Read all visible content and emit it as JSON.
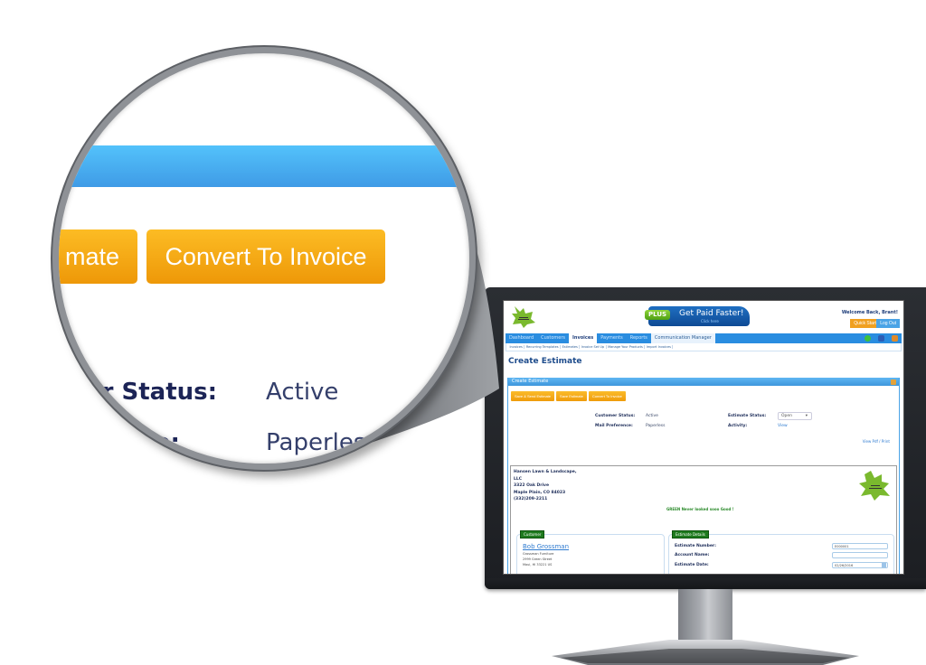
{
  "app": {
    "promo": {
      "badge": "PLUS",
      "title": "Get Paid Faster!",
      "subtitle": "Click here"
    },
    "welcome": "Welcome Back, Brant!",
    "header_buttons": {
      "quick_start": "Quick Start",
      "log_out": "Log Out"
    },
    "nav_tabs": [
      {
        "label": "Dashboard",
        "state": "normal"
      },
      {
        "label": "Customers",
        "state": "normal"
      },
      {
        "label": "Invoices",
        "state": "active"
      },
      {
        "label": "Payments",
        "state": "normal"
      },
      {
        "label": "Reports",
        "state": "normal"
      },
      {
        "label": "Communication Manager",
        "state": "light"
      }
    ],
    "nav_icons": [
      "settings-icon",
      "user-icon",
      "help-icon"
    ],
    "sub_nav": [
      "Invoices",
      "Recurring Templates",
      "Estimates",
      "Invoice Set Up",
      "Manage Your Products",
      "Import Invoices"
    ],
    "page_title": "Create Estimate",
    "panel_title": "Create Estimate",
    "action_buttons": [
      "Save & Send Estimate",
      "Save Estimate",
      "Convert To Invoice"
    ],
    "info": {
      "customer_status_label": "Customer Status:",
      "customer_status": "Active",
      "mail_preference_label": "Mail Preference:",
      "mail_preference": "Paperless",
      "estimate_status_label": "Estimate Status:",
      "estimate_status": "Open",
      "activity_label": "Activity:",
      "activity_link": "View"
    },
    "view_pdf": "View Pdf / Print",
    "company": {
      "line1": "Hansen Lawn & Landscape,",
      "line2": "LLC",
      "line3": "3322 Oak Drive",
      "line4": "Maple Plain, CO 84023",
      "line5": "(332)209-2211"
    },
    "slogan": "GREEN Never looked sooo Good !",
    "customer": {
      "legend": "Customer",
      "name": "Bob Grossman",
      "company": "Grossman Furniture",
      "street": "2999 Green Street",
      "city": "Maui, HI 33221 US"
    },
    "estimate_details": {
      "legend": "Estimate Details",
      "number_label": "Estimate Number:",
      "number_value": "E000001",
      "account_label": "Account Name:",
      "account_value": "",
      "date_label": "Estimate Date:",
      "date_value": "02/26/2016"
    }
  },
  "magnifier": {
    "partial_button": "mate",
    "convert_button": "Convert To Invoice",
    "status_label": "er Status:",
    "status_value": "Active",
    "pref_label": "nce:",
    "pref_value": "Paperless"
  },
  "colors": {
    "accent_blue": "#3f9be6",
    "button_orange": "#f0a020",
    "brand_green": "#6aaa1e",
    "title_blue": "#1e4c8c"
  }
}
